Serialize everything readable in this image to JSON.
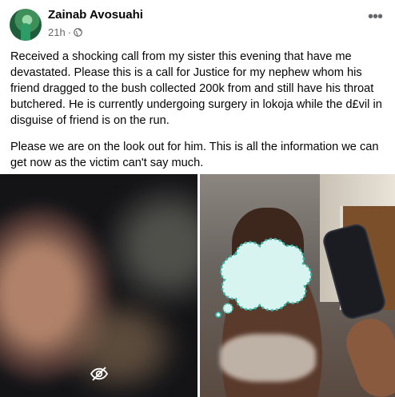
{
  "post": {
    "author": "Zainab Avosuahi",
    "time": "21h",
    "separator": "·",
    "privacy_icon": "globe-icon",
    "more_icon": "more-options-icon",
    "paragraph_1": "Received a shocking call from my sister this evening that have me devastated. Please this is a call for Justice for my nephew whom his friend dragged to the bush collected 200k from and still have his throat butchered. He is currently undergoing surgery in lokoja while the d£vil in disguise of friend is on the run.",
    "paragraph_2": "Please we are on the look out for him. This is all the information we can get now as the victim can't say much."
  },
  "media": {
    "left_icon": "hidden-content-icon",
    "right_icon": "face-cover-cloud"
  },
  "colors": {
    "text_primary": "#050505",
    "text_secondary": "#65676b"
  }
}
